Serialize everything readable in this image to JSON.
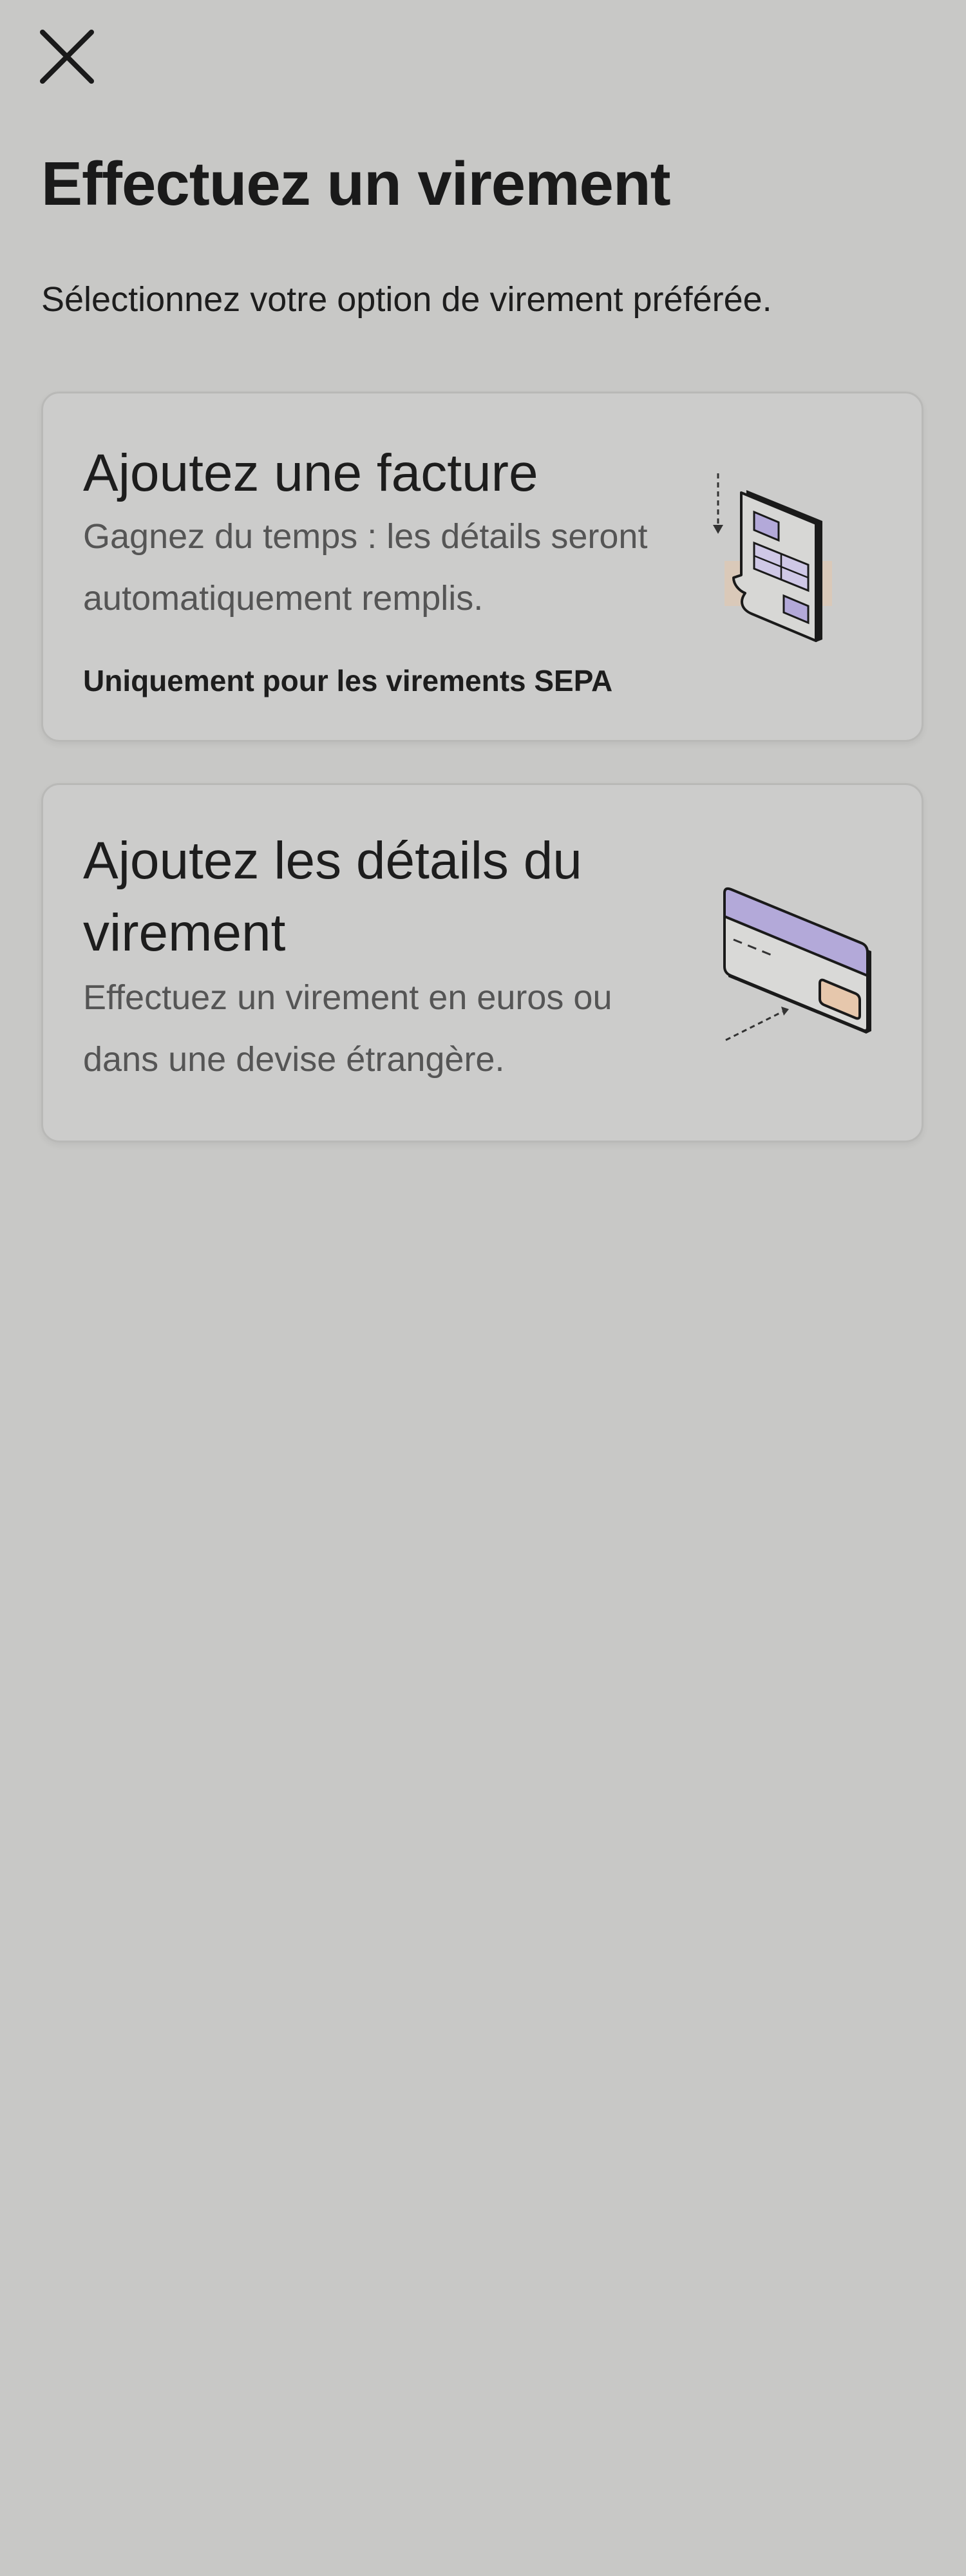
{
  "header": {
    "title": "Effectuez un virement",
    "subtitle": "Sélectionnez votre option de virement préférée."
  },
  "options": [
    {
      "title": "Ajoutez une facture",
      "description": "Gagnez du temps : les détails seront automatiquement remplis.",
      "note": "Uniquement pour les virements SEPA",
      "icon": "invoice-upload-icon"
    },
    {
      "title": "Ajoutez les détails du virement",
      "description": "Effectuez un virement en euros ou dans une devise étrangère.",
      "icon": "bank-card-details-icon"
    }
  ],
  "colors": {
    "background": "#c8c8c6",
    "card_background": "#cccccb",
    "accent_purple": "#b3a9d9",
    "accent_peach": "#e6c7ac"
  }
}
